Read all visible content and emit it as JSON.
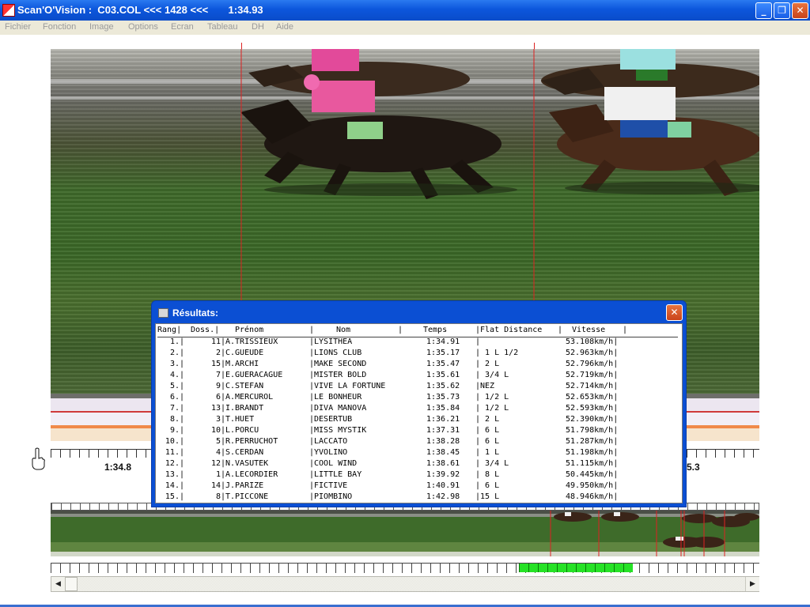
{
  "window": {
    "title": "Scan'O'Vision :  C03.COL <<< 1428 <<<       1:34.93",
    "minimize": "_",
    "restore": "❐",
    "close": "✕"
  },
  "menu": [
    "Fichier",
    "Fonction",
    "Image",
    "Options",
    "Ecran",
    "Tableau",
    "DH",
    "Aide"
  ],
  "timeline": {
    "left_label": "1:34.8",
    "right_label": "5.3"
  },
  "results": {
    "title": "Résultats:",
    "close": "✕",
    "columns": [
      "Rang|",
      "Doss.|",
      "Prénom",
      "|",
      "Nom",
      "|",
      "Temps",
      "|Flat Distance",
      "|",
      "Vitesse",
      "|"
    ],
    "rows": [
      {
        "rang": "1.|",
        "doss": "11|",
        "prenom": "A.TRISSIEUX",
        "nom": "|LYSITHEA",
        "temps": "1:34.91",
        "dist": "|",
        "vitesse": "53.108km/h|"
      },
      {
        "rang": "2.|",
        "doss": "2|",
        "prenom": "C.GUEUDE",
        "nom": "|LIONS CLUB",
        "temps": "1:35.17",
        "dist": "| 1 L 1/2",
        "vitesse": "52.963km/h|"
      },
      {
        "rang": "3.|",
        "doss": "15|",
        "prenom": "M.ARCHI",
        "nom": "|MAKE SECOND",
        "temps": "1:35.47",
        "dist": "| 2 L",
        "vitesse": "52.796km/h|"
      },
      {
        "rang": "4.|",
        "doss": "7|",
        "prenom": "E.GUERACAGUE",
        "nom": "|MISTER BOLD",
        "temps": "1:35.61",
        "dist": "| 3/4 L",
        "vitesse": "52.719km/h|"
      },
      {
        "rang": "5.|",
        "doss": "9|",
        "prenom": "C.STEFAN",
        "nom": "|VIVE LA FORTUNE",
        "temps": "1:35.62",
        "dist": "|NEZ",
        "vitesse": "52.714km/h|"
      },
      {
        "rang": "6.|",
        "doss": "6|",
        "prenom": "A.MERCUROL",
        "nom": "|LE BONHEUR",
        "temps": "1:35.73",
        "dist": "| 1/2 L",
        "vitesse": "52.653km/h|"
      },
      {
        "rang": "7.|",
        "doss": "13|",
        "prenom": "I.BRANDT",
        "nom": "|DIVA MANOVA",
        "temps": "1:35.84",
        "dist": "| 1/2 L",
        "vitesse": "52.593km/h|"
      },
      {
        "rang": "8.|",
        "doss": "3|",
        "prenom": "T.HUET",
        "nom": "|DESERTUB",
        "temps": "1:36.21",
        "dist": "| 2 L",
        "vitesse": "52.390km/h|"
      },
      {
        "rang": "9.|",
        "doss": "10|",
        "prenom": "L.PORCU",
        "nom": "|MISS MYSTIK",
        "temps": "1:37.31",
        "dist": "| 6 L",
        "vitesse": "51.798km/h|"
      },
      {
        "rang": "10.|",
        "doss": "5|",
        "prenom": "R.PERRUCHOT",
        "nom": "|LACCATO",
        "temps": "1:38.28",
        "dist": "| 6 L",
        "vitesse": "51.287km/h|"
      },
      {
        "rang": "11.|",
        "doss": "4|",
        "prenom": "S.CERDAN",
        "nom": "|YVOLINO",
        "temps": "1:38.45",
        "dist": "| 1 L",
        "vitesse": "51.198km/h|"
      },
      {
        "rang": "12.|",
        "doss": "12|",
        "prenom": "N.VASUTEK",
        "nom": "|COOL WIND",
        "temps": "1:38.61",
        "dist": "| 3/4 L",
        "vitesse": "51.115km/h|"
      },
      {
        "rang": "13.|",
        "doss": "1|",
        "prenom": "A.LECORDIER",
        "nom": "|LITTLE BAY",
        "temps": "1:39.92",
        "dist": "| 8 L",
        "vitesse": "50.445km/h|"
      },
      {
        "rang": "14.|",
        "doss": "14|",
        "prenom": "J.PARIZE",
        "nom": "|FICTIVE",
        "temps": "1:40.91",
        "dist": "| 6 L",
        "vitesse": "49.950km/h|"
      },
      {
        "rang": "15.|",
        "doss": "8|",
        "prenom": "T.PICCONE",
        "nom": "|PIOMBINO",
        "temps": "1:42.98",
        "dist": "|15 L",
        "vitesse": "48.946km/h|"
      }
    ]
  },
  "scrollbar": {
    "left": "◀",
    "right": "▶"
  }
}
